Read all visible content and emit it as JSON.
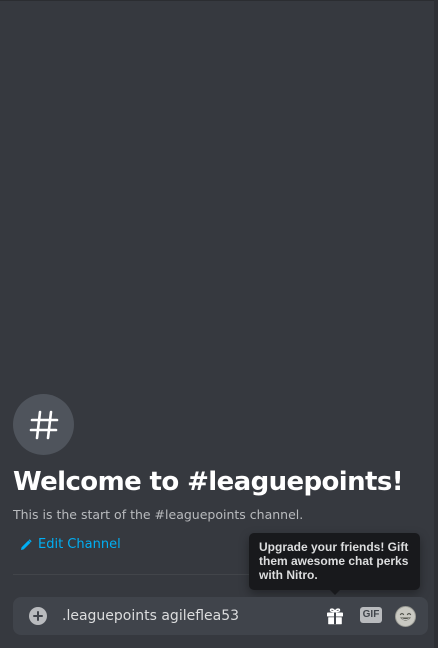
{
  "channel": {
    "hash_symbol": "#",
    "welcome_title": "Welcome to #leaguepoints!",
    "welcome_subtitle": "This is the start of the #leaguepoints channel.",
    "edit_label": "Edit Channel"
  },
  "tooltip": {
    "text": "Upgrade your friends! Gift them awesome chat perks with Nitro."
  },
  "composer": {
    "value": ".leaguepoints agileflea53",
    "gif_label": "GIF"
  },
  "colors": {
    "background": "#36393f",
    "link": "#00aff4",
    "composer": "#40444b",
    "tooltip": "#18191c"
  },
  "icons": {
    "channel": "hash-icon",
    "edit": "pencil-icon",
    "attach": "plus-circle-icon",
    "gift": "gift-icon",
    "emoji": "emoji-icon"
  }
}
